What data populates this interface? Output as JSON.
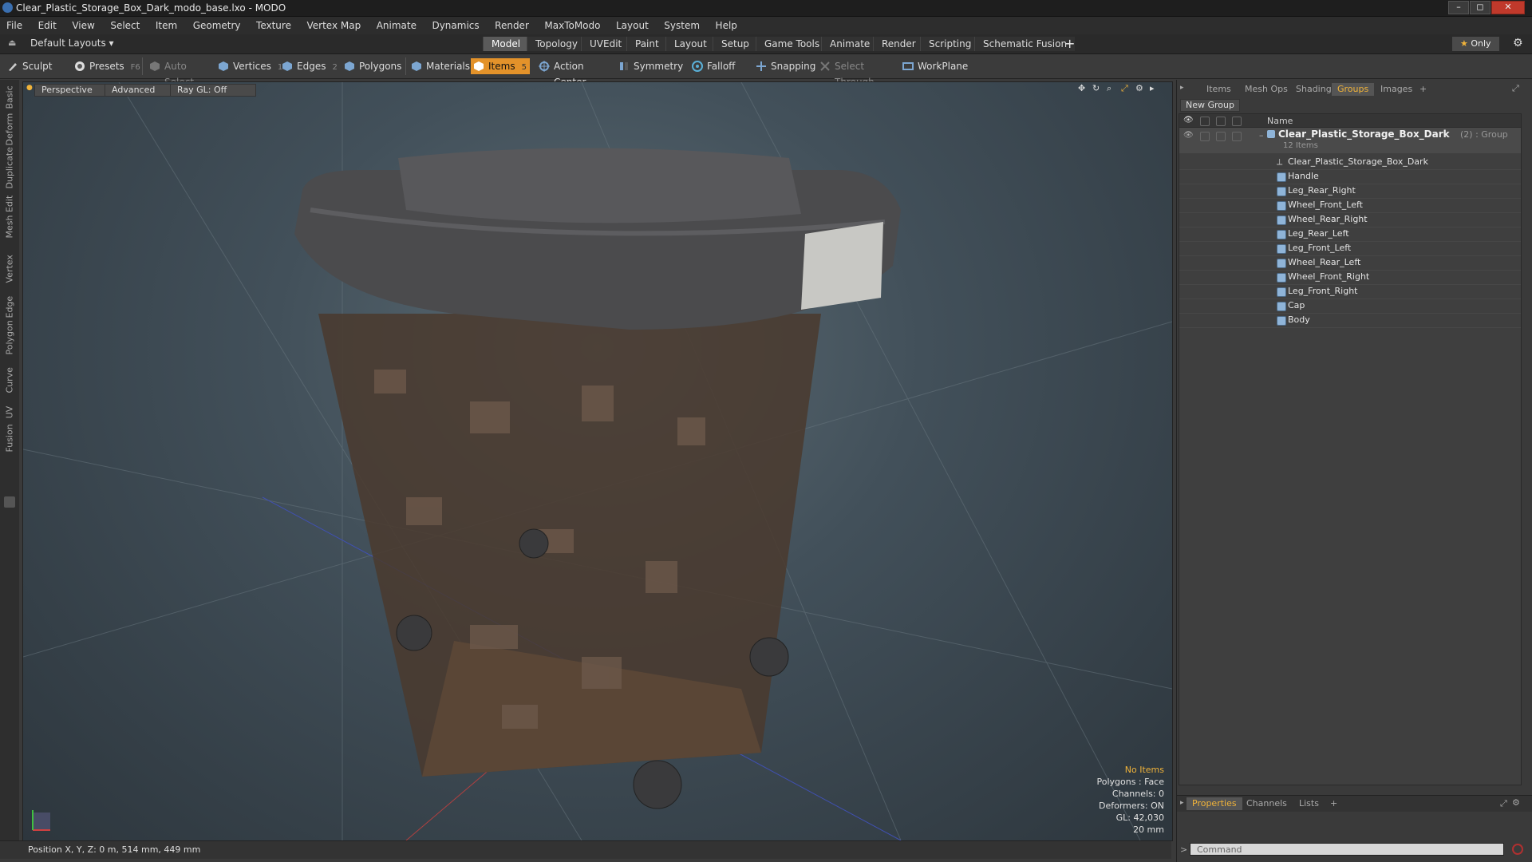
{
  "window": {
    "title": "Clear_Plastic_Storage_Box_Dark_modo_base.lxo - MODO",
    "minimize": "–",
    "maximize": "◻",
    "close": "✕"
  },
  "menubar": [
    "File",
    "Edit",
    "View",
    "Select",
    "Item",
    "Geometry",
    "Texture",
    "Vertex Map",
    "Animate",
    "Dynamics",
    "Render",
    "MaxToModo",
    "Layout",
    "System",
    "Help"
  ],
  "layoutbar": {
    "layout_selector": "Default Layouts",
    "tabs": [
      "Model",
      "Topology",
      "UVEdit",
      "Paint",
      "Layout",
      "Setup",
      "Game Tools",
      "Animate",
      "Render",
      "Scripting",
      "Schematic Fusion"
    ],
    "active_tab": "Model",
    "add": "+",
    "only_label": "Only"
  },
  "toolbar": {
    "sculpt": "Sculpt",
    "presets": "Presets",
    "presets_key": "F6",
    "auto_select": "Auto Select",
    "vertices": "Vertices",
    "vertices_count": "1",
    "edges": "Edges",
    "edges_count": "2",
    "polygons": "Polygons",
    "materials": "Materials",
    "items": "Items",
    "items_count": "5",
    "action_center": "Action Center",
    "symmetry": "Symmetry",
    "falloff": "Falloff",
    "snapping": "Snapping",
    "select_through": "Select Through",
    "workplane": "WorkPlane"
  },
  "left_tabs": [
    "Basic",
    "Deform",
    "Duplicate",
    "Mesh Edit",
    "Vertex",
    "Edge",
    "Polygon",
    "Curve",
    "UV",
    "Fusion"
  ],
  "viewport": {
    "perspective": "Perspective",
    "advanced": "Advanced",
    "raygl": "Ray GL: Off",
    "info": {
      "no_items": "No Items",
      "polygons": "Polygons : Face",
      "channels": "Channels: 0",
      "deformers": "Deformers: ON",
      "gl": "GL: 42,030",
      "scale": "20 mm"
    }
  },
  "statusbar": {
    "position": "Position X, Y, Z:  0 m, 514 mm, 449 mm"
  },
  "right_panel": {
    "tabs": [
      "Items",
      "Mesh Ops",
      "Shading",
      "Groups",
      "Images"
    ],
    "active_tab": "Groups",
    "new_group": "New Group",
    "column_name": "Name",
    "group_name": "Clear_Plastic_Storage_Box_Dark",
    "group_suffix": "(2) : Group",
    "group_count": "12 Items",
    "items": [
      "Clear_Plastic_Storage_Box_Dark",
      "Handle",
      "Leg_Rear_Right",
      "Wheel_Front_Left",
      "Wheel_Rear_Right",
      "Leg_Rear_Left",
      "Leg_Front_Left",
      "Wheel_Rear_Left",
      "Wheel_Front_Right",
      "Leg_Front_Right",
      "Cap",
      "Body"
    ],
    "bottom_tabs": [
      "Properties",
      "Channels",
      "Lists"
    ],
    "active_bottom_tab": "Properties",
    "command_placeholder": "Command"
  },
  "colors": {
    "accent": "#e3922a",
    "active_tab_text": "#f0b33a",
    "viewport_bg": "#42505a"
  }
}
